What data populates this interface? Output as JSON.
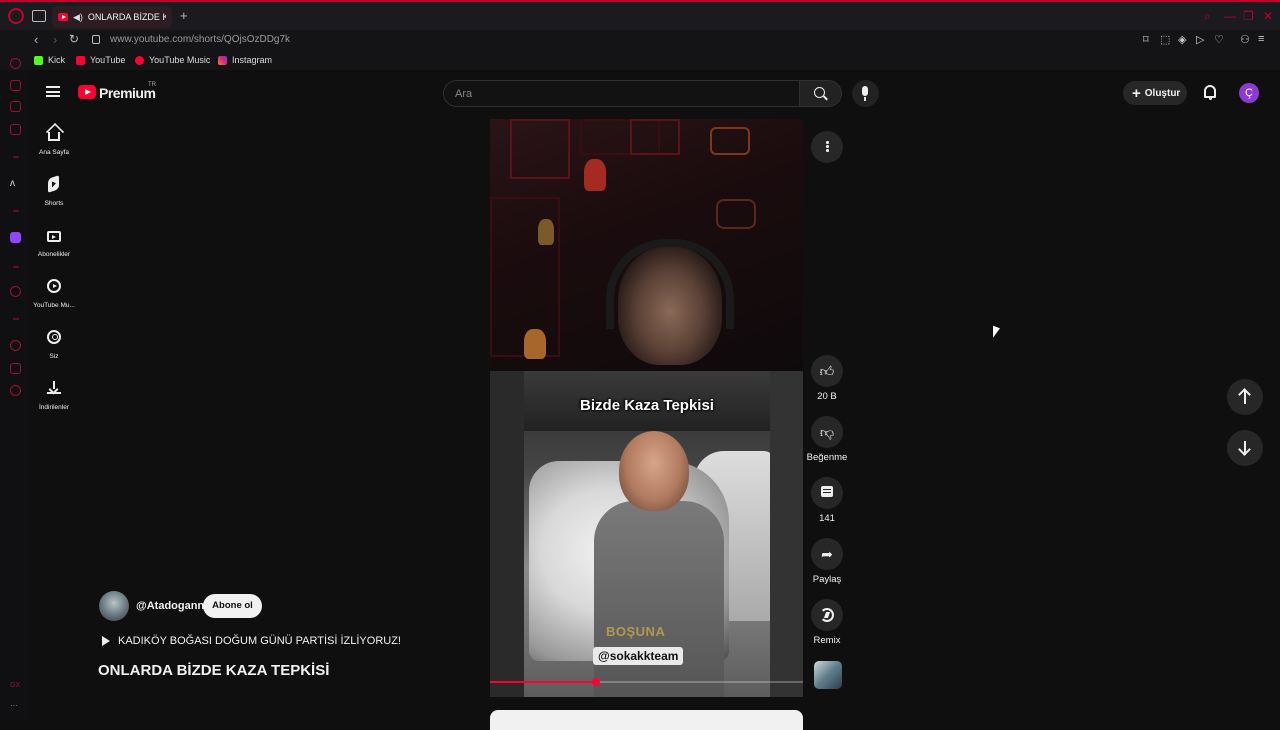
{
  "browser": {
    "tab_title": "ONLARDA BİZDE KAZ",
    "new_tab_symbol": "+",
    "url": "www.youtube.com/shorts/QOjsOzDDg7k",
    "bookmarks": [
      {
        "label": "Kick",
        "color": "#53fc18"
      },
      {
        "label": "YouTube",
        "color": "#ff0033"
      },
      {
        "label": "YouTube Music",
        "color": "#ff0033"
      },
      {
        "label": "Instagram",
        "color": "#e1306c"
      }
    ],
    "accent_color": "#c2002b"
  },
  "header": {
    "logo_text": "Premium",
    "logo_region": "TR",
    "search_placeholder": "Ara",
    "create_label": "Oluştur",
    "avatar_letter": "Ç"
  },
  "sidebar": {
    "items": [
      {
        "label": "Ana Sayfa",
        "icon": "home-icon"
      },
      {
        "label": "Shorts",
        "icon": "shorts-icon"
      },
      {
        "label": "Abonelikler",
        "icon": "subscriptions-icon"
      },
      {
        "label": "YouTube Mu...",
        "icon": "youtube-music-icon"
      },
      {
        "label": "Siz",
        "icon": "you-icon"
      },
      {
        "label": "İndirilenler",
        "icon": "download-icon"
      }
    ]
  },
  "short": {
    "overlay_title": "Bizde Kaza Tepkisi",
    "watermark_faded": "BOŞUNA",
    "channel_tag": "@sokakkteam",
    "progress": 0.34,
    "channel_handle": "@Atadogann",
    "subscribe_label": "Abone ol",
    "playlist_title": "KADIKÖY BOĞASI DOĞUM GÜNÜ PARTİSİ İZLİYORUZ!",
    "title": "ONLARDA BİZDE KAZA TEPKİSİ"
  },
  "actions": {
    "like_count": "20 B",
    "dislike_label": "Beğenme",
    "comment_count": "141",
    "share_label": "Paylaş",
    "remix_label": "Remix"
  }
}
